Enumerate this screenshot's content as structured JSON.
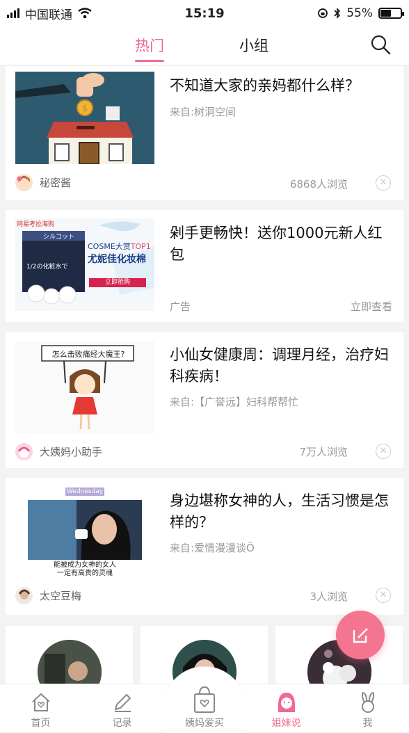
{
  "status": {
    "carrier": "中国联通",
    "time": "15:19",
    "battery": "55%",
    "battery_fraction": 0.55
  },
  "topnav": {
    "tab_hot": "热门",
    "tab_group": "小组"
  },
  "posts": [
    {
      "title": "不知道大家的亲妈都什么样？",
      "source": "来自:树洞空间",
      "author": "秘密酱",
      "views": "6868人浏览"
    },
    {
      "title": "剁手更畅快！送你1000元新人红包",
      "ad_label": "广告",
      "ad_link": "立即查看",
      "ad_brand": "网易考拉海购",
      "ad_product": "シルコット",
      "ad_slogan1": "COSME大赏",
      "ad_slogan_hl": "TOP1",
      "ad_slogan2": "尤妮佳化妆棉",
      "ad_button": "立即抢购",
      "ad_fraction": "1/2の化粧水で"
    },
    {
      "title": "小仙女健康周：调理月经，治疗妇科疾病！",
      "source": "来自:【广誉远】妇科帮帮忙",
      "author": "大姨妈小助手",
      "views": "7万人浏览",
      "sign_text": "怎么击败痛经大魔王?"
    },
    {
      "title": "身边堪称女神的人，生活习惯是怎样的？",
      "source": "来自:爱情漫漫谈Ō",
      "author": "太空豆梅",
      "views": "3人浏览",
      "img_tag": "Wednesday",
      "img_caption1": "能被成为女神的女人",
      "img_caption2": "一定有高贵的灵魂"
    }
  ],
  "tabbar": {
    "home": "首页",
    "record": "记录",
    "shop": "姨妈爱买",
    "sisters": "姐妹说",
    "me": "我"
  },
  "colors": {
    "accent": "#f06a92",
    "fab": "#f4758f"
  }
}
